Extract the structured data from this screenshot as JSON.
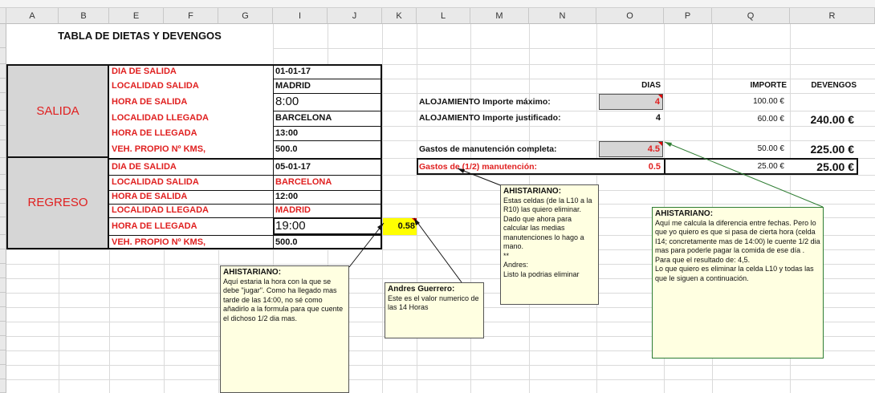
{
  "columns": [
    "A",
    "B",
    "E",
    "F",
    "G",
    "I",
    "J",
    "K",
    "L",
    "M",
    "N",
    "O",
    "P",
    "Q",
    "R"
  ],
  "title": "TABLA DE DIETAS Y DEVENGOS",
  "salida": {
    "section_label": "SALIDA",
    "rows": [
      {
        "label": "DIA DE SALIDA",
        "value": "01-01-17"
      },
      {
        "label": "LOCALIDAD  SALIDA",
        "value": "MADRID"
      },
      {
        "label": "HORA  DE  SALIDA",
        "value": "8:00"
      },
      {
        "label": "LOCALIDAD   LLEGADA",
        "value": "BARCELONA"
      },
      {
        "label": "HORA  DE  LLEGADA",
        "value": "13:00"
      },
      {
        "label": "VEH. PROPIO  Nº KMS,",
        "value": "500.0"
      }
    ]
  },
  "regreso": {
    "section_label": "REGRESO",
    "rows": [
      {
        "label": "DIA DE SALIDA",
        "value": "05-01-17"
      },
      {
        "label": "LOCALIDAD  SALIDA",
        "value": "BARCELONA"
      },
      {
        "label": "HORA  DE  SALIDA",
        "value": "12:00"
      },
      {
        "label": "LOCALIDAD   LLEGADA",
        "value": "MADRID"
      },
      {
        "label": "HORA  DE  LLEGADA",
        "value": "19:00"
      },
      {
        "label": "VEH. PROPIO  Nº KMS,",
        "value": "500.0"
      }
    ]
  },
  "k_value": "0.58",
  "summary": {
    "headers": {
      "dias": "DIAS",
      "importe": "IMPORTE",
      "devengos": "DEVENGOS"
    },
    "rows": [
      {
        "label": "ALOJAMIENTO Importe máximo:",
        "dias": "4",
        "importe": "100.00 €",
        "devengos": ""
      },
      {
        "label": "ALOJAMIENTO Importe justificado:",
        "dias": "4",
        "importe": "60.00 €",
        "devengos": "240.00 €"
      },
      {
        "label": "Gastos de manutención completa:",
        "dias": "4.5",
        "importe": "50.00 €",
        "devengos": "225.00 €"
      },
      {
        "label": "Gastos de (1/2) manutención:",
        "dias": "0.5",
        "importe": "25.00 €",
        "devengos": "25.00 €"
      }
    ]
  },
  "comments": {
    "c1": {
      "author": "AHISTARIANO:",
      "text": "Aquí estaria la hora con la que se debe \"jugar\". Como ha llegado mas tarde de las 14:00, no sé como añadirlo a la formula para que cuente el dichoso 1/2 dia mas."
    },
    "c2": {
      "author": "Andres Guerrero:",
      "text": "Este es el valor numerico de las  14 Horas"
    },
    "c3": {
      "author": "AHISTARIANO:",
      "text": "Estas celdas (de la L10 a la R10) las quiero eliminar. Dado que ahora para calcular las medias manutenciones lo hago a mano.",
      "extra1": "**",
      "extra2": "Andres:",
      "extra3": "Listo la podrias eliminar"
    },
    "c4": {
      "author": "AHISTARIANO:",
      "text": "Aquí me calcula la diferencia entre fechas. Pero lo que yo quiero es que si pasa de cierta hora (celda I14; concretamente mas de 14:00) le cuente 1/2 dia mas para poderle pagar la comida de ese día . Para que el resultado de: 4,5.",
      "extra1": "Lo que quiero es eliminar la celda L10 y todas las que le siguen a continuación."
    }
  },
  "colors": {
    "red": "#e02020",
    "gray": "#d6d6d6",
    "yellow": "#ffff00",
    "note": "#ffffe1",
    "arrow": "#2e7d32"
  }
}
